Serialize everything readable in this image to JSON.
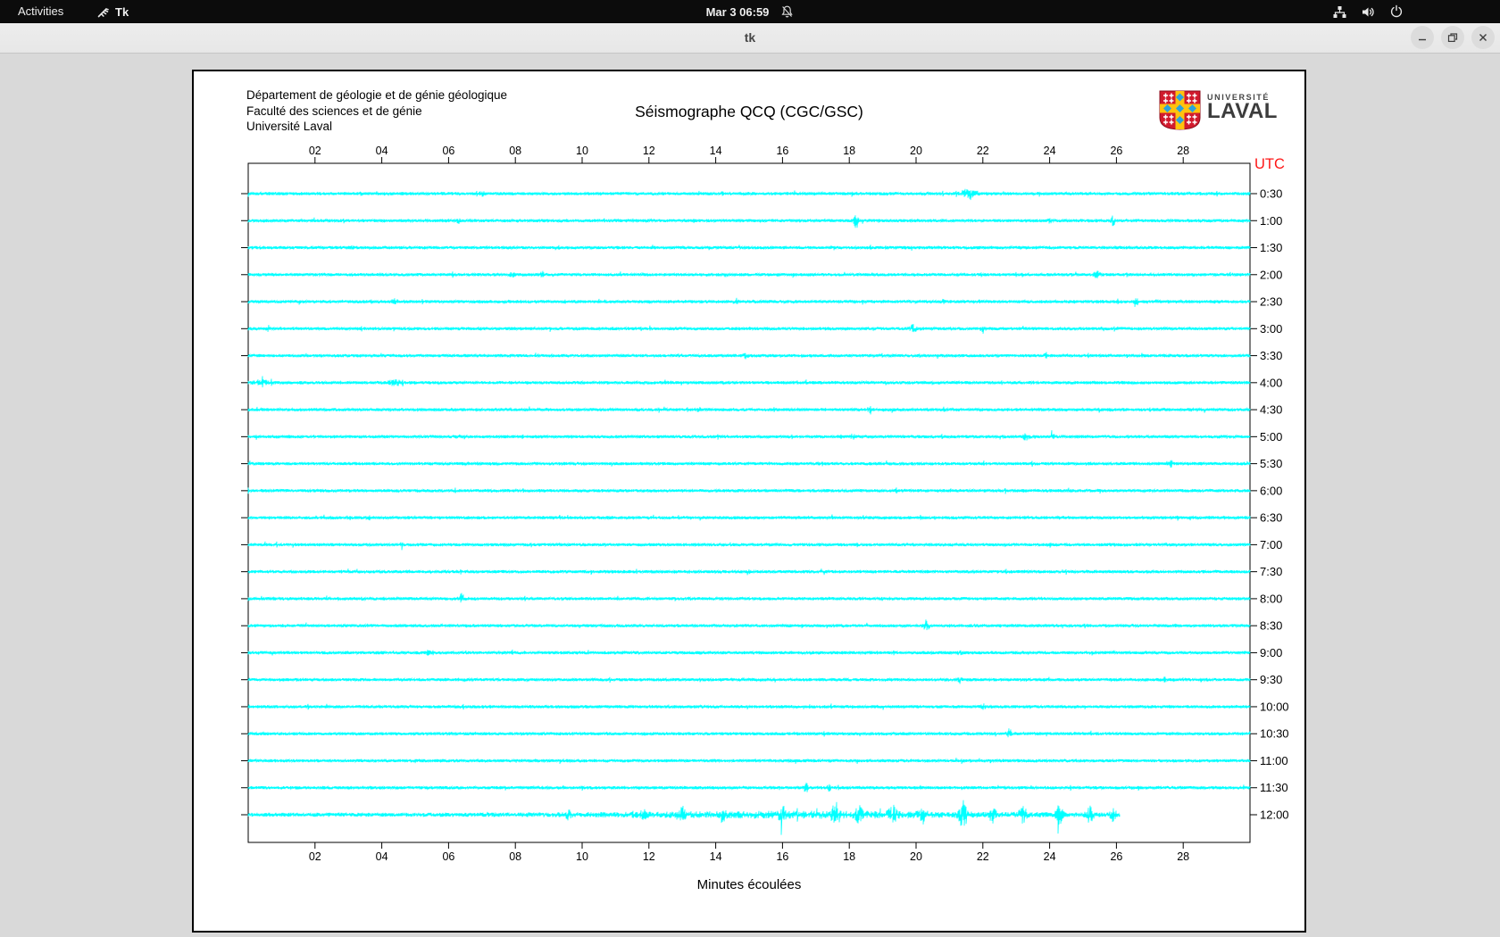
{
  "topbar": {
    "activities_label": "Activities",
    "app_name": "Tk",
    "clock": "Mar 3 06:59"
  },
  "titlebar": {
    "title": "tk"
  },
  "canvas": {
    "org_lines": [
      "Département de géologie et de génie géologique",
      "Faculté des sciences et de génie",
      "Université Laval"
    ],
    "title": "Séismographe QCQ (CGC/GSC)",
    "logo": {
      "line1": "UNIVERSITÉ",
      "line2": "LAVAL"
    },
    "utc": "UTC",
    "xlabel": "Minutes écoulées"
  },
  "chart_data": {
    "type": "line",
    "subtype": "helicorder-seismogram",
    "title": "Séismographe QCQ (CGC/GSC)",
    "xlabel": "Minutes écoulées",
    "ylabel_right": "UTC",
    "x_range": [
      0,
      30
    ],
    "x_ticks": [
      "02",
      "04",
      "06",
      "08",
      "10",
      "12",
      "14",
      "16",
      "18",
      "20",
      "22",
      "24",
      "26",
      "28"
    ],
    "trace_color": "#00ffff",
    "axis_color": "#000000",
    "utc_color": "#fe1616",
    "legend_position": "none",
    "grid": false,
    "rows": [
      {
        "label": "0:30",
        "events": [
          {
            "m": 7.0,
            "a": 4,
            "w": 0.05
          },
          {
            "m": 14.2,
            "a": 2,
            "w": 0.05
          },
          {
            "m": 21.6,
            "a": 5.5,
            "w": 0.22
          }
        ]
      },
      {
        "label": "1:00",
        "events": [
          {
            "m": 6.3,
            "a": 2.5,
            "w": 0.06
          },
          {
            "m": 18.2,
            "a": 8,
            "w": 0.07
          },
          {
            "m": 24.0,
            "a": 2.5,
            "w": 0.05
          },
          {
            "m": 25.9,
            "a": 4.5,
            "w": 0.06
          }
        ]
      },
      {
        "label": "1:30",
        "events": [
          {
            "m": 3.1,
            "a": 2.5,
            "w": 0.05
          },
          {
            "m": 17.5,
            "a": 2,
            "w": 0.05
          }
        ]
      },
      {
        "label": "2:00",
        "events": [
          {
            "m": 7.9,
            "a": 4,
            "w": 0.06
          },
          {
            "m": 8.8,
            "a": 3,
            "w": 0.05
          },
          {
            "m": 25.4,
            "a": 3.5,
            "w": 0.1
          }
        ]
      },
      {
        "label": "2:30",
        "events": [
          {
            "m": 4.4,
            "a": 3.5,
            "w": 0.06
          },
          {
            "m": 14.6,
            "a": 3.5,
            "w": 0.06
          },
          {
            "m": 20.8,
            "a": 2.5,
            "w": 0.05
          },
          {
            "m": 26.6,
            "a": 4.5,
            "w": 0.07
          }
        ]
      },
      {
        "label": "3:00",
        "events": [
          {
            "m": 0.6,
            "a": 3,
            "w": 0.05
          },
          {
            "m": 19.9,
            "a": 3.5,
            "w": 0.1
          },
          {
            "m": 22.0,
            "a": 4,
            "w": 0.06
          },
          {
            "m": 25.6,
            "a": 3,
            "w": 0.05
          }
        ]
      },
      {
        "label": "3:30",
        "events": [
          {
            "m": 14.9,
            "a": 2.5,
            "w": 0.05
          },
          {
            "m": 23.9,
            "a": 2.5,
            "w": 0.05
          }
        ]
      },
      {
        "label": "4:00",
        "events": [
          {
            "m": 0.4,
            "a": 2.5,
            "w": 0.25
          },
          {
            "m": 4.4,
            "a": 3,
            "w": 0.18
          }
        ]
      },
      {
        "label": "4:30",
        "events": [
          {
            "m": 13.5,
            "a": 2,
            "w": 0.05
          },
          {
            "m": 18.6,
            "a": 2.5,
            "w": 0.05
          }
        ]
      },
      {
        "label": "5:00",
        "events": [
          {
            "m": 18.1,
            "a": 3.5,
            "w": 0.06
          },
          {
            "m": 23.3,
            "a": 3.5,
            "w": 0.09
          },
          {
            "m": 24.1,
            "a": 3,
            "w": 0.05
          }
        ]
      },
      {
        "label": "5:30",
        "events": [
          {
            "m": 27.6,
            "a": 3.5,
            "w": 0.09
          }
        ]
      },
      {
        "label": "6:00",
        "events": [
          {
            "m": 19.4,
            "a": 2.5,
            "w": 0.05
          }
        ]
      },
      {
        "label": "6:30",
        "events": []
      },
      {
        "label": "7:00",
        "events": [
          {
            "m": 4.6,
            "a": 5.5,
            "w": 0.04
          }
        ]
      },
      {
        "label": "7:30",
        "events": [
          {
            "m": 15.0,
            "a": 2.5,
            "w": 0.05
          }
        ]
      },
      {
        "label": "8:00",
        "events": [
          {
            "m": 6.4,
            "a": 6.5,
            "w": 0.05
          }
        ]
      },
      {
        "label": "8:30",
        "events": [
          {
            "m": 20.3,
            "a": 5.5,
            "w": 0.09
          }
        ]
      },
      {
        "label": "9:00",
        "events": [
          {
            "m": 5.4,
            "a": 2.5,
            "w": 0.05
          },
          {
            "m": 21.3,
            "a": 2,
            "w": 0.05
          }
        ]
      },
      {
        "label": "9:30",
        "events": [
          {
            "m": 21.3,
            "a": 3,
            "w": 0.06
          }
        ]
      },
      {
        "label": "10:00",
        "events": [
          {
            "m": 22.0,
            "a": 3,
            "w": 0.05
          }
        ]
      },
      {
        "label": "10:30",
        "events": [
          {
            "m": 22.8,
            "a": 5.5,
            "w": 0.05
          }
        ]
      },
      {
        "label": "11:00",
        "events": []
      },
      {
        "label": "11:30",
        "events": [
          {
            "m": 16.7,
            "a": 7.5,
            "w": 0.05
          },
          {
            "m": 17.4,
            "a": 3.5,
            "w": 0.05
          }
        ]
      },
      {
        "label": "12:00",
        "end_minute": 26.1,
        "noise": 1.4,
        "events": [
          {
            "m": 17,
            "a": 2.2,
            "w": 6
          },
          {
            "m": 9.6,
            "a": 5,
            "w": 0.08
          },
          {
            "m": 11.8,
            "a": 7,
            "w": 0.1
          },
          {
            "m": 13.0,
            "a": 8,
            "w": 0.08
          },
          {
            "m": 14.2,
            "a": 6,
            "w": 0.08
          },
          {
            "m": 16.0,
            "a": 7,
            "w": 0.1
          },
          {
            "m": 17.6,
            "a": 11,
            "w": 0.12
          },
          {
            "m": 18.3,
            "a": 8,
            "w": 0.1
          },
          {
            "m": 19.3,
            "a": 9,
            "w": 0.1
          },
          {
            "m": 20.2,
            "a": 7,
            "w": 0.1
          },
          {
            "m": 21.4,
            "a": 13,
            "w": 0.12
          },
          {
            "m": 22.3,
            "a": 7,
            "w": 0.1
          },
          {
            "m": 23.2,
            "a": 8,
            "w": 0.1
          },
          {
            "m": 24.3,
            "a": 9,
            "w": 0.1
          },
          {
            "m": 25.2,
            "a": 8,
            "w": 0.1
          },
          {
            "m": 25.9,
            "a": 7,
            "w": 0.08
          }
        ]
      }
    ]
  }
}
